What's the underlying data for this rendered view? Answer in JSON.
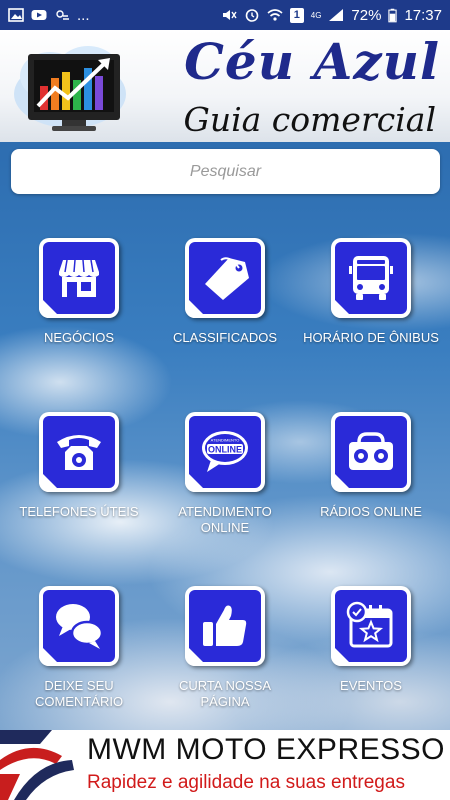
{
  "status_bar": {
    "dots": "...",
    "battery": "72%",
    "time": "17:37",
    "network": "4G",
    "sim_badge": "1"
  },
  "header": {
    "title": "Céu Azul",
    "subtitle": "Guia comercial"
  },
  "search": {
    "placeholder": "Pesquisar"
  },
  "menu": [
    {
      "label": "NEGÓCIOS",
      "icon": "store-icon"
    },
    {
      "label": "CLASSIFICADOS",
      "icon": "price-tag-icon"
    },
    {
      "label": "HORÁRIO DE ÔNIBUS",
      "icon": "bus-icon"
    },
    {
      "label": "TELEFONES ÚTEIS",
      "icon": "telephone-icon"
    },
    {
      "label": "ATENDIMENTO ONLINE",
      "icon": "online-chat-icon",
      "badge_top": "ATENDIMENTO",
      "badge_main": "ONLINE"
    },
    {
      "label": "RÁDIOS ONLINE",
      "icon": "radio-icon"
    },
    {
      "label": "DEIXE SEU COMENTÁRIO",
      "icon": "comment-bubbles-icon"
    },
    {
      "label": "CURTA NOSSA PÁGINA",
      "icon": "thumbs-up-icon"
    },
    {
      "label": "EVENTOS",
      "icon": "calendar-star-icon"
    }
  ],
  "ad": {
    "title": "MWM MOTO EXPRESSO",
    "tagline": "Rapidez e agilidade na suas entregas"
  },
  "colors": {
    "status_bar": "#1e3a8a",
    "tile_blue": "#2a2ad8",
    "brand_blue": "#1f2a8c",
    "ad_red": "#d11a1a"
  }
}
